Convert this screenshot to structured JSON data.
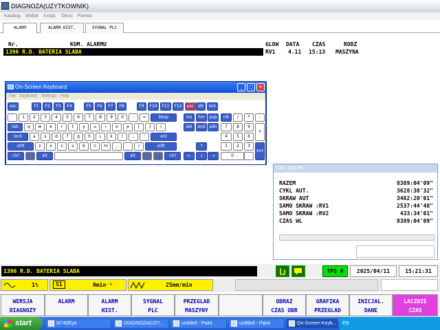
{
  "window": {
    "title": "DIAGNOZA(UZYTKOWNIK)"
  },
  "menu": [
    "Katalog",
    "Widok",
    "Instal.",
    "Okno",
    "Pomoc"
  ],
  "tabs": [
    "ALARM",
    "ALARM HIST.",
    "SYGNAL PLC"
  ],
  "alarm_columns": {
    "nr": "Nr.",
    "kom": "KOM. ALARMU",
    "glow": "GLOW",
    "data": "DATA",
    "czas": "CZAS",
    "rodz": "RODZ"
  },
  "alarm_rows": [
    {
      "nr_kom": "1396 R.D. BATERIA SLABA",
      "glow": "RV1",
      "data": "4.11",
      "czas": "15:13",
      "rodz": "MASZYNA"
    }
  ],
  "osk": {
    "title": "On-Screen Keyboard",
    "menu": [
      "File",
      "Keyboard",
      "Settings",
      "Help"
    ],
    "rows": [
      [
        "esc",
        "F1",
        "F2",
        "F3",
        "F4",
        "F5",
        "F6",
        "F7",
        "F8",
        "F9",
        "F10",
        "F11",
        "F12",
        "psc",
        "slk",
        "brk"
      ],
      [
        "`",
        "1",
        "2",
        "3",
        "4",
        "5",
        "6",
        "7",
        "8",
        "9",
        "0",
        "-",
        "=",
        "bksp",
        "ins",
        "hm",
        "pup",
        "nlk",
        "/",
        "*",
        "-"
      ],
      [
        "tab",
        "q",
        "w",
        "e",
        "r",
        "t",
        "y",
        "u",
        "i",
        "o",
        "p",
        "[",
        "]",
        "\\",
        "del",
        "end",
        "pdn",
        "7",
        "8",
        "9",
        "+"
      ],
      [
        "lock",
        "a",
        "s",
        "d",
        "f",
        "g",
        "h",
        "j",
        "k",
        "l",
        ";",
        "'",
        "ent",
        "4",
        "5",
        "6"
      ],
      [
        "shft",
        "z",
        "x",
        "c",
        "v",
        "b",
        "n",
        "m",
        ",",
        ".",
        "/",
        "shft",
        "↑",
        "1",
        "2",
        "3",
        "ent"
      ],
      [
        "ctrl",
        "",
        "alt",
        "",
        "alt",
        "",
        "",
        "ctrl",
        "←",
        "↓",
        "→",
        "0",
        "."
      ]
    ]
  },
  "czas_ogolem": {
    "title": "CZAS OGOLEM",
    "rows": [
      {
        "label": "RAZEM",
        "value": "8389:04'09\""
      },
      {
        "label": "CYKL AUT.",
        "value": "3628:38'32\""
      },
      {
        "label": "SKRAW AUT",
        "value": "3482:20'01\""
      },
      {
        "label": "SAMO SKRAW :RV1",
        "value": "2537:44'48\""
      },
      {
        "label": "SAMO SKRAW :RV2",
        "value": "433:34'01\""
      },
      {
        "label": "CZAS WL",
        "value": "8389:04'09\""
      }
    ]
  },
  "status": {
    "message": "1396 R.D. BATERIA SLABA",
    "tps": "TPS 0",
    "date": "2025/04/11",
    "time": "15:21:31"
  },
  "info": {
    "spindle_override": "1%",
    "s_label": "S1",
    "spindle_speed": "0min⁻¹",
    "feed": "25mm/min"
  },
  "function_keys": [
    "WERSJA\nDIAGNOZY",
    "ALARM",
    "ALARM\nHIST.",
    "SYGNAL\nPLC",
    "PRZEGLAD\nMASZYNY",
    "",
    "OBRAZ\nCZAS OBR",
    "GRAFIKA\nPRZEGLAD",
    "INICJAL.\nDANE",
    "LACZNIE\nCZAS"
  ],
  "taskbar": {
    "start": "start",
    "tasks": [
      "M740Eye",
      "DIAGNOZA(UZY...",
      "untitled - Paint",
      "untitled - Paint",
      "On-Screen Keyb..."
    ],
    "tray": "EN"
  },
  "colors": {
    "accent_pink": "#e040e0",
    "alarm_bg": "#000000",
    "alarm_fg": "#ffff00",
    "tps_green": "#00e000"
  }
}
